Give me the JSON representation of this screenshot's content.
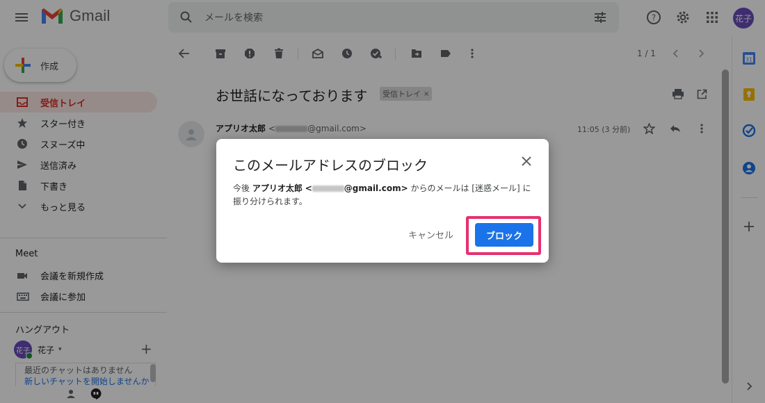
{
  "header": {
    "app_name": "Gmail",
    "search_placeholder": "メールを検索",
    "avatar_label": "花子"
  },
  "sidebar": {
    "compose_label": "作成",
    "nav": [
      {
        "label": "受信トレイ",
        "icon": "inbox-icon",
        "active": true
      },
      {
        "label": "スター付き",
        "icon": "star-icon",
        "active": false
      },
      {
        "label": "スヌーズ中",
        "icon": "clock-icon",
        "active": false
      },
      {
        "label": "送信済み",
        "icon": "send-icon",
        "active": false
      },
      {
        "label": "下書き",
        "icon": "draft-icon",
        "active": false
      },
      {
        "label": "もっと見る",
        "icon": "chevron-down-icon",
        "active": false
      }
    ],
    "meet": {
      "title": "Meet",
      "new_meeting": "会議を新規作成",
      "join_meeting": "会議に参加"
    },
    "hangouts": {
      "title": "ハングアウト",
      "user_name": "花子",
      "user_avatar": "花子",
      "no_chats": "最近のチャットはありません",
      "start_chat": "新しいチャットを開始しませんか"
    }
  },
  "toolbar": {
    "pager": "1 / 1"
  },
  "email": {
    "subject": "お世話になっております",
    "label": "受信トレイ",
    "label_remove": "×",
    "sender_name": "アプリオ太郎",
    "sender_addr_prefix": "<",
    "sender_addr_suffix": "@gmail.com>",
    "time": "11:05 (3 分前)"
  },
  "dialog": {
    "title": "このメールアドレスのブロック",
    "body_prefix": "今後",
    "body_name": "アプリオ太郎",
    "body_addr_prefix": "<",
    "body_addr_suffix": "@gmail.com>",
    "body_rest": "からのメールは [迷惑メール] に振り分けられます。",
    "cancel_label": "キャンセル",
    "block_label": "ブロック"
  },
  "colors": {
    "accent_blue": "#1a73e8",
    "highlight_pink": "#e6306d",
    "active_red": "#d93025"
  }
}
